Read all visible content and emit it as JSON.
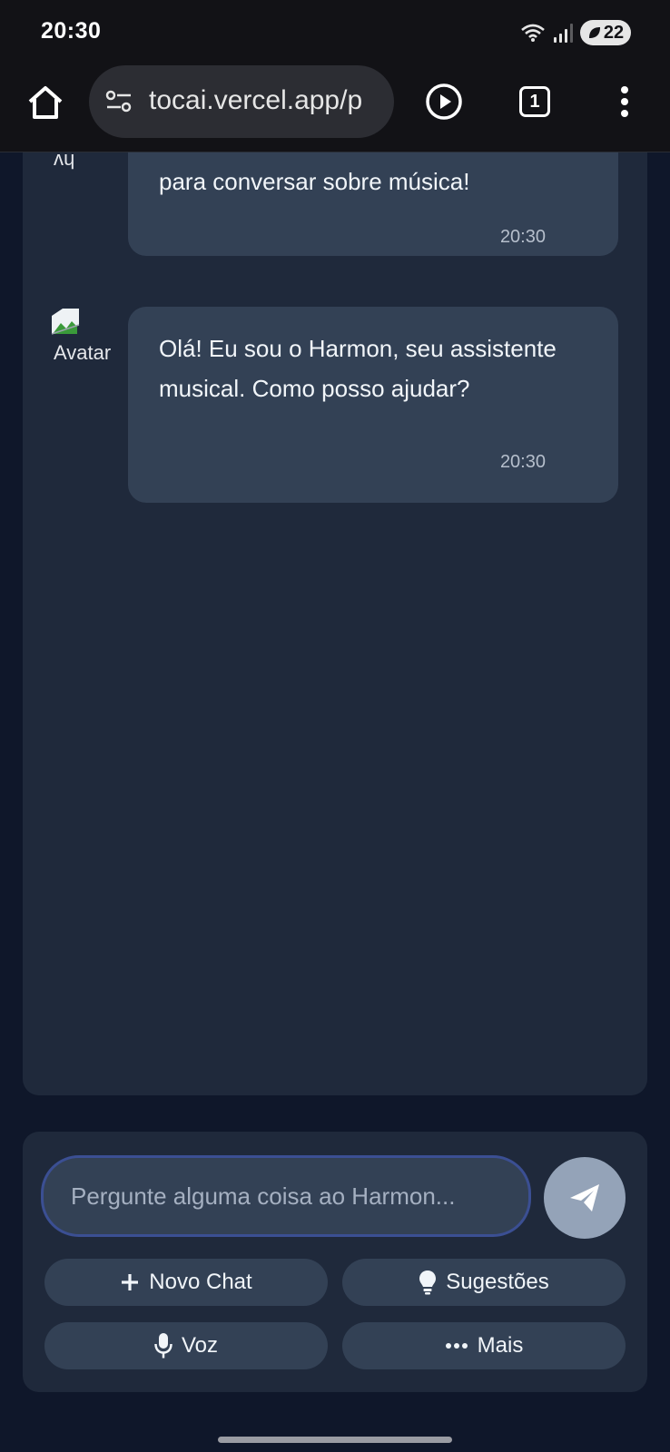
{
  "status_bar": {
    "time": "20:30",
    "battery_level": "22",
    "icons": [
      "wifi-icon",
      "signal-icon",
      "battery-saver-icon"
    ]
  },
  "browser": {
    "url": "tocai.vercel.app/p",
    "tab_count": "1",
    "icons": [
      "home-icon",
      "site-settings-icon",
      "play-icon",
      "tabs-icon",
      "more-vert-icon"
    ]
  },
  "chat": {
    "messages": [
      {
        "sender": "user",
        "text": "para conversar sobre música!",
        "time": "20:30"
      },
      {
        "sender": "assistant",
        "avatar_alt": "Avatar",
        "text": "Olá! Eu sou o Harmon, seu assistente musical. Como posso ajudar?",
        "time": "20:30"
      }
    ]
  },
  "composer": {
    "placeholder": "Pergunte alguma coisa ao Harmon...",
    "actions": {
      "new_chat": "Novo Chat",
      "suggestions": "Sugestões",
      "voice": "Voz",
      "more": "Mais"
    }
  },
  "colors": {
    "page_bg": "#0f172a",
    "panel_bg": "#1f293b",
    "bubble_bg": "#334155",
    "send_button": "#94a3b8",
    "input_border": "#3b4f93"
  }
}
